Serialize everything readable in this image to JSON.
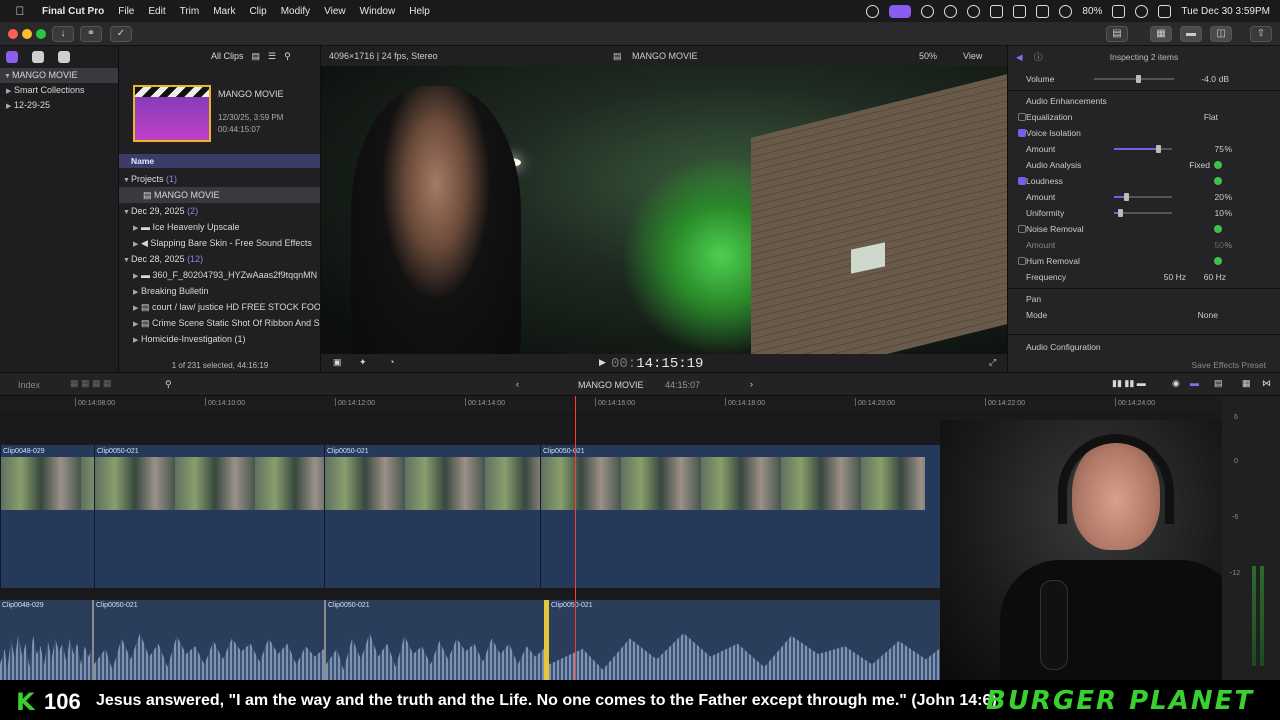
{
  "menubar": {
    "app": "Final Cut Pro",
    "items": [
      "File",
      "Edit",
      "Trim",
      "Mark",
      "Clip",
      "Modify",
      "View",
      "Window",
      "Help"
    ],
    "battery": "80%",
    "clock": "Tue Dec 30  3:59PM"
  },
  "library": {
    "items": [
      {
        "label": "MANGO MOVIE"
      },
      {
        "label": "Smart Collections"
      },
      {
        "label": "12-29-25"
      }
    ]
  },
  "browser": {
    "filter": "All Clips",
    "project": {
      "name": "MANGO MOVIE",
      "date": "12/30/25, 3:59 PM",
      "duration": "00:44:15:07"
    },
    "column": "Name",
    "groups": [
      {
        "label": "Projects",
        "count": "(1)",
        "items": [
          "MANGO MOVIE"
        ]
      },
      {
        "label": "Dec 29, 2025",
        "count": "(2)",
        "items": [
          "Ice Heavenly Upscale",
          "Slapping Bare Skin - Free Sound Effects"
        ]
      },
      {
        "label": "Dec 28, 2025",
        "count": "(12)",
        "items": [
          "360_F_80204793_HYZwAaas2f9tqqnMN",
          "Breaking Bulletin",
          "court / law/ justice HD FREE STOCK FOO",
          "Crime Scene Static Shot Of Ribbon And S",
          "Homicide-Investigation (1)"
        ]
      }
    ],
    "footer": "1 of 231 selected, 44:16:19"
  },
  "viewer": {
    "format": "4096×1716 | 24 fps, Stereo",
    "title": "MANGO MOVIE",
    "zoom": "50%",
    "view": "View",
    "timecode_dim": "00:",
    "timecode": "14:15:19"
  },
  "inspector": {
    "header": "Inspecting 2 items",
    "volume": {
      "label": "Volume",
      "value": "-4.0",
      "unit": "dB"
    },
    "enhancements": "Audio Enhancements",
    "equalization": {
      "label": "Equalization",
      "value": "Flat"
    },
    "voice_isolation": {
      "label": "Voice Isolation",
      "amount_label": "Amount",
      "amount": "75",
      "unit": "%",
      "level": 0.75
    },
    "analysis": {
      "label": "Audio Analysis",
      "value": "Fixed"
    },
    "loudness": {
      "label": "Loudness",
      "amount_label": "Amount",
      "amount": "20",
      "uniformity_label": "Uniformity",
      "uniformity": "10",
      "unit": "%",
      "amount_level": 0.2,
      "uniformity_level": 0.1
    },
    "noise": {
      "label": "Noise Removal",
      "amount_label": "Amount",
      "amount": "50",
      "unit": "%"
    },
    "hum": {
      "label": "Hum Removal",
      "freq_label": "Frequency",
      "opt1": "50 Hz",
      "opt2": "60 Hz"
    },
    "pan": {
      "label": "Pan",
      "mode_label": "Mode",
      "mode": "None"
    },
    "config": "Audio Configuration",
    "save": "Save Effects Preset"
  },
  "timeline": {
    "index": "Index",
    "project": "MANGO MOVIE",
    "duration": "44:15:07",
    "ruler": [
      "00:14:08:00",
      "00:14:10:00",
      "00:14:12:00",
      "00:14:14:00",
      "00:14:16:00",
      "00:14:18:00",
      "00:14:20:00",
      "00:14:22:00",
      "00:14:24:00"
    ],
    "video_clips": [
      "Clip0048-029",
      "Clip0050-021",
      "Clip0050-021",
      "Clip0050-021"
    ],
    "audio_clips": [
      "Clip0048-029",
      "Clip0050-021",
      "Clip0050-021",
      "Clip0050-021"
    ],
    "meter_labels": [
      "6",
      "0",
      "-6",
      "-12"
    ]
  },
  "ticker": {
    "letter": "K",
    "number": "106",
    "verse": "Jesus answered, \"I am the way and the truth and the Life. No one comes to the Father except through me.\" (John 14:6)",
    "brand": "BURGER PLANET"
  }
}
